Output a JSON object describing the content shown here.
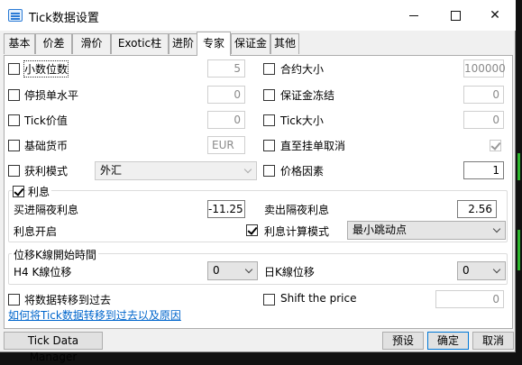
{
  "window": {
    "title": "Tick数据设置",
    "close_glyph": "✕"
  },
  "tabs": [
    "基本",
    "价差",
    "滑价",
    "Exotic柱",
    "进阶",
    "专家",
    "保证金",
    "其他"
  ],
  "active_tab": "专家",
  "fields": {
    "decimal_places": {
      "label": "小数位数",
      "value": "5"
    },
    "contract_size": {
      "label": "合约大小",
      "value": "100000"
    },
    "stop_level": {
      "label": "停损单水平",
      "value": "0"
    },
    "margin_freeze": {
      "label": "保证金冻结",
      "value": "0"
    },
    "tick_value": {
      "label": "Tick价值",
      "value": "0"
    },
    "tick_size": {
      "label": "Tick大小",
      "value": "0"
    },
    "base_currency": {
      "label": "基础货币",
      "value": "EUR"
    },
    "cancel_until_filled": {
      "label": "直至挂单取消",
      "checked": true
    },
    "profit_mode": {
      "label": "获利模式",
      "value": "外汇"
    },
    "price_factor": {
      "label": "价格因素",
      "value": "1"
    }
  },
  "swap": {
    "title": "利息",
    "checked": true,
    "long_label": "买进隔夜利息",
    "long_value": "-11.25",
    "short_label": "卖出隔夜利息",
    "short_value": "2.56",
    "start_label": "利息开启",
    "start_checked": true,
    "calc_mode_label": "利息计算模式",
    "calc_mode_value": "最小跳动点"
  },
  "shift_group": {
    "title": "位移K線開始時間",
    "h4_label": "H4 K線位移",
    "h4_value": "0",
    "d1_label": "日K線位移",
    "d1_value": "0"
  },
  "shift_data": {
    "label": "将数据转移到过去",
    "checked": false
  },
  "shift_price": {
    "label": "Shift the price",
    "checked": false,
    "value": "0"
  },
  "help_link": "如何将Tick数据转移到过去以及原因",
  "buttons": {
    "tick_manager": "Tick Data Manager",
    "preset": "预设",
    "ok": "确定",
    "cancel": "取消"
  }
}
